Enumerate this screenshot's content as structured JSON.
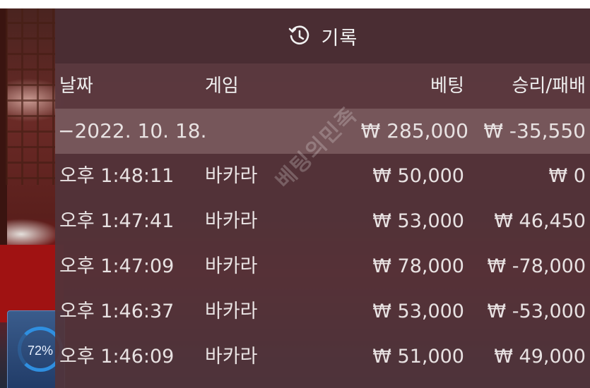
{
  "background": {
    "timer_percent": "72%"
  },
  "panel": {
    "title": "기록",
    "title_icon": "history-icon",
    "columns": {
      "date": "날짜",
      "game": "게임",
      "bet": "베팅",
      "win_loss": "승리/패배"
    },
    "summary": {
      "date": "−2022. 10. 18.",
      "bet": "₩ 285,000",
      "win_loss": "₩ -35,550"
    },
    "rows": [
      {
        "time": "오후 1:48:11",
        "game": "바카라",
        "bet": "₩ 50,000",
        "win_loss": "₩ 0"
      },
      {
        "time": "오후 1:47:41",
        "game": "바카라",
        "bet": "₩ 53,000",
        "win_loss": "₩ 46,450"
      },
      {
        "time": "오후 1:47:09",
        "game": "바카라",
        "bet": "₩ 78,000",
        "win_loss": "₩ -78,000"
      },
      {
        "time": "오후 1:46:37",
        "game": "바카라",
        "bet": "₩ 53,000",
        "win_loss": "₩ -53,000"
      },
      {
        "time": "오후 1:46:09",
        "game": "바카라",
        "bet": "₩ 51,000",
        "win_loss": "₩ 49,000"
      }
    ],
    "watermark": "베팅의민족"
  },
  "colors": {
    "panel_bg": "#52343a",
    "text": "#ececec",
    "timer_accent": "#2f8fe0"
  }
}
